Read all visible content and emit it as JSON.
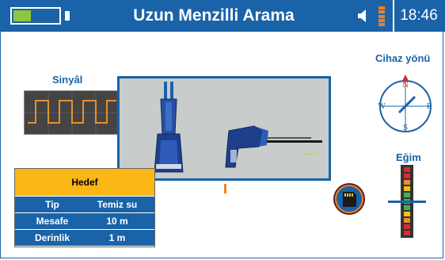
{
  "header": {
    "title": "Uzun Menzilli Arama",
    "time": "18:46",
    "battery_level": 0.4,
    "volume_bars": 5
  },
  "signal": {
    "label": "Sinyâl"
  },
  "compass": {
    "label": "Cihaz yönü",
    "directions": {
      "n": "N",
      "e": "E",
      "s": "S",
      "w": "W"
    }
  },
  "tilt": {
    "label": "Eğim"
  },
  "target": {
    "title": "Hedef",
    "rows": [
      {
        "key": "Tip",
        "value": "Temiz su"
      },
      {
        "key": "Mesafe",
        "value": "10  m"
      },
      {
        "key": "Derinlik",
        "value": "1 m"
      }
    ]
  },
  "colors": {
    "primary": "#1a63a8",
    "accent": "#f2811d",
    "highlight": "#fbb715",
    "battery": "#8dc63f",
    "signal_wave": "#e8902e"
  }
}
